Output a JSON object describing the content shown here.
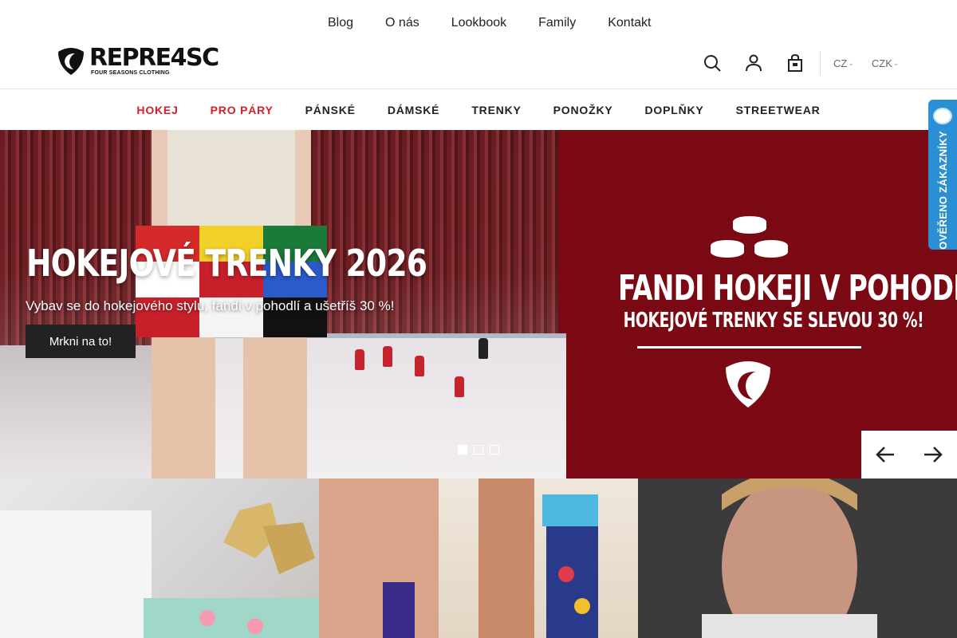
{
  "topbar": {
    "links": [
      "Blog",
      "O nás",
      "Lookbook",
      "Family",
      "Kontakt"
    ]
  },
  "header": {
    "logo_text": "REPRE4SC",
    "logo_tagline": "FOUR SEASONS CLOTHING",
    "icons": [
      "search-icon",
      "user-icon",
      "cart-icon"
    ],
    "language": "CZ",
    "currency": "CZK"
  },
  "nav": {
    "items": [
      {
        "label": "HOKEJ",
        "highlight": true
      },
      {
        "label": "PRO PÁRY",
        "highlight": true
      },
      {
        "label": "PÁNSKÉ",
        "highlight": false
      },
      {
        "label": "DÁMSKÉ",
        "highlight": false
      },
      {
        "label": "TRENKY",
        "highlight": false
      },
      {
        "label": "PONOŽKY",
        "highlight": false
      },
      {
        "label": "DOPLŇKY",
        "highlight": false
      },
      {
        "label": "STREETWEAR",
        "highlight": false
      }
    ]
  },
  "hero": {
    "title": "HOKEJOVÉ TRENKY 2026",
    "subtitle": "Vybav se do hokejového stylu, fandi v pohodlí a ušetříš 30 %!",
    "cta": "Mrkni na to!",
    "promo_line1": "FANDI HOKEJI V POHODLÍ!",
    "promo_line2": "HOKEJOVÉ TRENKY SE SLEVOU 30 %!",
    "slides_total": 3,
    "active_slide": 1
  },
  "badge": {
    "text": "OVĚŘENO ZÁKAZNÍKY"
  },
  "colors": {
    "accent_red": "#d3202a",
    "hero_bg": "#7a0913",
    "badge_blue": "#2a8fd4"
  }
}
